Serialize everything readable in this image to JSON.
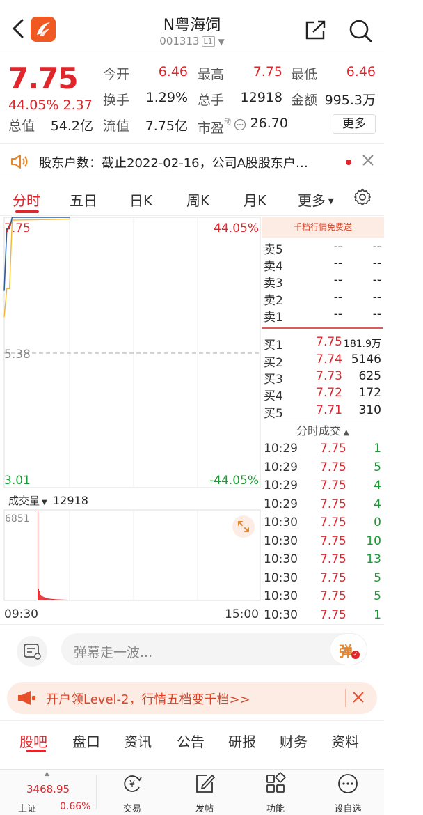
{
  "header": {
    "title": "N粤海饲",
    "code": "001313",
    "level_badge": "L1"
  },
  "quote": {
    "price": "7.75",
    "change_pct": "44.05%",
    "change_amt": "2.37",
    "open_label": "今开",
    "open": "6.46",
    "high_label": "最高",
    "high": "7.75",
    "low_label": "最低",
    "low": "6.46",
    "turnover_label": "换手",
    "turnover": "1.29%",
    "volume_label": "总手",
    "volume": "12918",
    "amount_label": "金额",
    "amount": "995.3万",
    "total_value_label": "总值",
    "total_value": "54.2亿",
    "float_value_label": "流值",
    "float_value": "7.75亿",
    "pe_label": "市盈",
    "pe_sup": "动",
    "pe": "26.70",
    "more_label": "更多"
  },
  "notice": {
    "text": "股东户数：截止2022-02-16，公司A股股东户…"
  },
  "chart_tabs": [
    "分时",
    "五日",
    "日K",
    "周K",
    "月K",
    "更多"
  ],
  "chart": {
    "price_top": "7.75",
    "price_mid": "5.38",
    "price_bottom": "3.01",
    "pct_top": "44.05%",
    "pct_bottom": "-44.05%",
    "volume_label": "成交量",
    "volume_value": "12918",
    "volume_max": "6851",
    "time_start": "09:30",
    "time_end": "15:00"
  },
  "chart_data": {
    "type": "line",
    "price_range": [
      3.01,
      7.75
    ],
    "price_series": [
      {
        "t": "09:30",
        "price": 6.46,
        "avg": 6.0
      },
      {
        "t": "09:31",
        "price": 7.55,
        "avg": 6.5
      },
      {
        "t": "09:32",
        "price": 7.55,
        "avg": 6.5
      },
      {
        "t": "09:33",
        "price": 7.75,
        "avg": 7.7
      },
      {
        "t": "10:30",
        "price": 7.75,
        "avg": 7.72
      }
    ],
    "volume_max": 6851
  },
  "order_book": {
    "free_banner": "千档行情免费送",
    "sell": [
      {
        "label": "卖5",
        "price": "--",
        "vol": "--"
      },
      {
        "label": "卖4",
        "price": "--",
        "vol": "--"
      },
      {
        "label": "卖3",
        "price": "--",
        "vol": "--"
      },
      {
        "label": "卖2",
        "price": "--",
        "vol": "--"
      },
      {
        "label": "卖1",
        "price": "--",
        "vol": "--"
      }
    ],
    "buy": [
      {
        "label": "买1",
        "price": "7.75",
        "vol": "181.9万"
      },
      {
        "label": "买2",
        "price": "7.74",
        "vol": "5146"
      },
      {
        "label": "买3",
        "price": "7.73",
        "vol": "625"
      },
      {
        "label": "买4",
        "price": "7.72",
        "vol": "172"
      },
      {
        "label": "买5",
        "price": "7.71",
        "vol": "310"
      }
    ]
  },
  "trades": {
    "header": "分时成交",
    "rows": [
      {
        "time": "10:29",
        "price": "7.75",
        "vol": "1"
      },
      {
        "time": "10:29",
        "price": "7.75",
        "vol": "5"
      },
      {
        "time": "10:29",
        "price": "7.75",
        "vol": "4"
      },
      {
        "time": "10:29",
        "price": "7.75",
        "vol": "4"
      },
      {
        "time": "10:30",
        "price": "7.75",
        "vol": "0"
      },
      {
        "time": "10:30",
        "price": "7.75",
        "vol": "10"
      },
      {
        "time": "10:30",
        "price": "7.75",
        "vol": "13"
      },
      {
        "time": "10:30",
        "price": "7.75",
        "vol": "5"
      },
      {
        "time": "10:30",
        "price": "7.75",
        "vol": "5"
      },
      {
        "time": "10:30",
        "price": "7.75",
        "vol": "1"
      }
    ]
  },
  "comment": {
    "placeholder": "弹幕走一波...",
    "button": "弹"
  },
  "promo": {
    "text": "开户领Level-2，行情五档变千档>>"
  },
  "info_tabs": [
    "股吧",
    "盘口",
    "资讯",
    "公告",
    "研报",
    "财务",
    "资料"
  ],
  "bottom_nav": {
    "index_value": "3468.95",
    "index_name": "上证",
    "index_change": "0.66%",
    "items": [
      "交易",
      "发帖",
      "功能",
      "设自选"
    ]
  },
  "colors": {
    "up": "#e0252b",
    "down": "#1a9a32",
    "accent": "#f05a22",
    "price_line": "#2d5d9b",
    "avg_line": "#f2b632"
  }
}
